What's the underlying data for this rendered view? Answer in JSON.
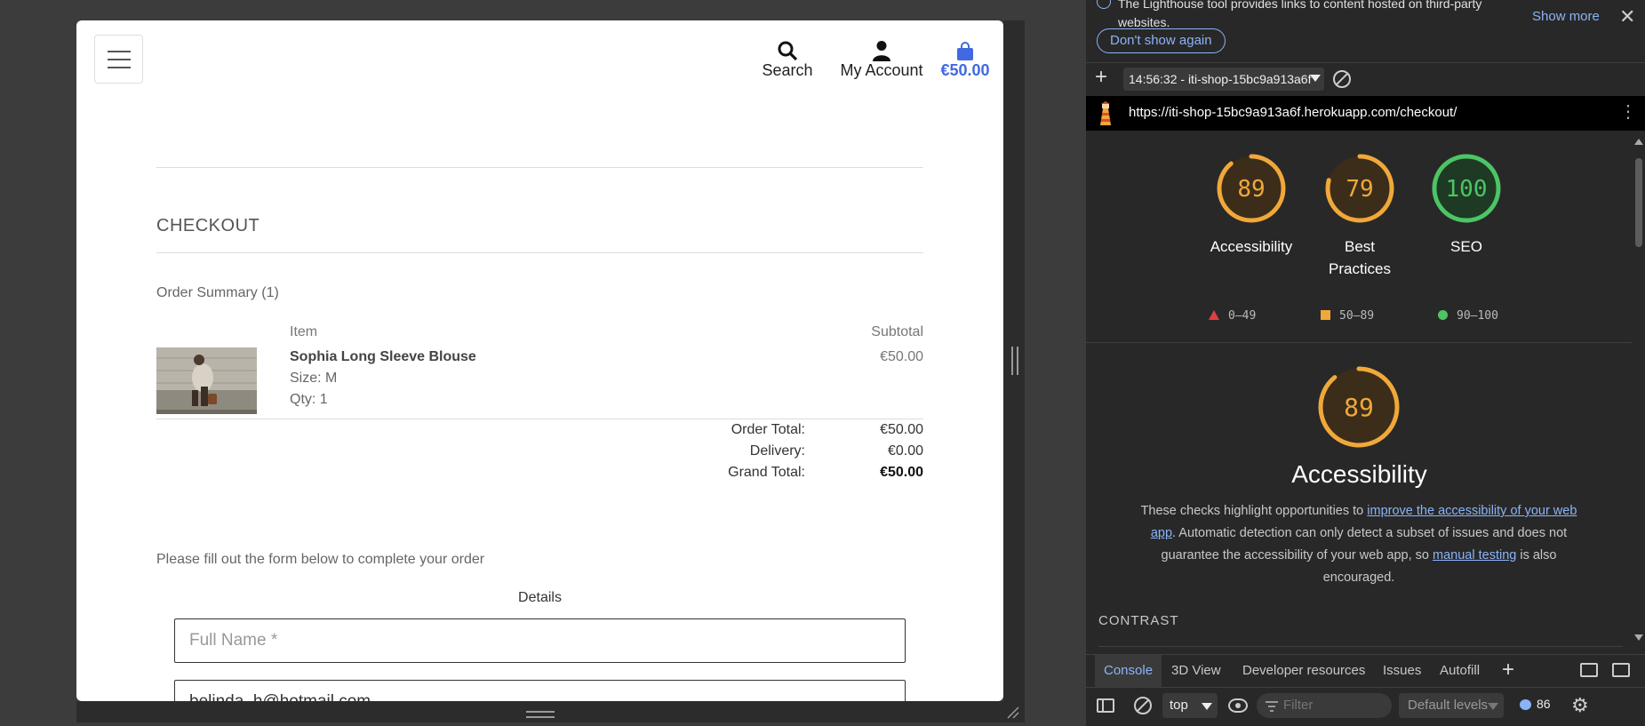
{
  "page": {
    "header": {
      "search_label": "Search",
      "account_label": "My Account",
      "cart_total": "€50.00"
    },
    "checkout_title": "CHECKOUT",
    "order_summary": "Order Summary (1)",
    "columns": {
      "item": "Item",
      "subtotal": "Subtotal"
    },
    "product": {
      "name": "Sophia Long Sleeve Blouse",
      "size": "Size: M",
      "qty": "Qty: 1",
      "subtotal": "€50.00"
    },
    "totals": {
      "order_total_label": "Order Total:",
      "order_total": "€50.00",
      "delivery_label": "Delivery:",
      "delivery": "€0.00",
      "grand_total_label": "Grand Total:",
      "grand_total": "€50.00"
    },
    "form_intro": "Please fill out the form below to complete your order",
    "details_label": "Details",
    "full_name_placeholder": "Full Name *",
    "email_value": "belinda_h@hotmail.com"
  },
  "devtools": {
    "info_text": "The Lighthouse tool provides links to content hosted on third-party websites.",
    "show_more": "Show more",
    "dont_show_again": "Don't show again",
    "report_select": "14:56:32 - iti-shop-15bc9a913a6f",
    "url": "https://iti-shop-15bc9a913a6f.herokuapp.com/checkout/",
    "gauges": [
      {
        "score": "89",
        "label": "Accessibility",
        "color": "#f0a83a"
      },
      {
        "score": "79",
        "label": "Best Practices",
        "color": "#f0a83a"
      },
      {
        "score": "100",
        "label": "SEO",
        "color": "#4cc564"
      }
    ],
    "legend": {
      "fail": "0–49",
      "average": "50–89",
      "pass": "90–100"
    },
    "legend_colors": {
      "fail": "#e04040",
      "average": "#f0a83a",
      "pass": "#4cc564"
    },
    "accessibility": {
      "score": "89",
      "title": "Accessibility",
      "desc_1": "These checks highlight opportunities to ",
      "link_1": "improve the accessibility of your web app",
      "desc_2": ". Automatic detection can only detect a subset of issues and does not guarantee the accessibility of your web app, so ",
      "link_2": "manual testing",
      "desc_3": " is also encouraged."
    },
    "contrast_heading": "CONTRAST",
    "drawer_tabs": [
      "Console",
      "3D View",
      "Developer resources",
      "Issues",
      "Autofill"
    ],
    "context": "top",
    "filter_placeholder": "Filter",
    "levels": "Default levels",
    "message_count": "86"
  }
}
